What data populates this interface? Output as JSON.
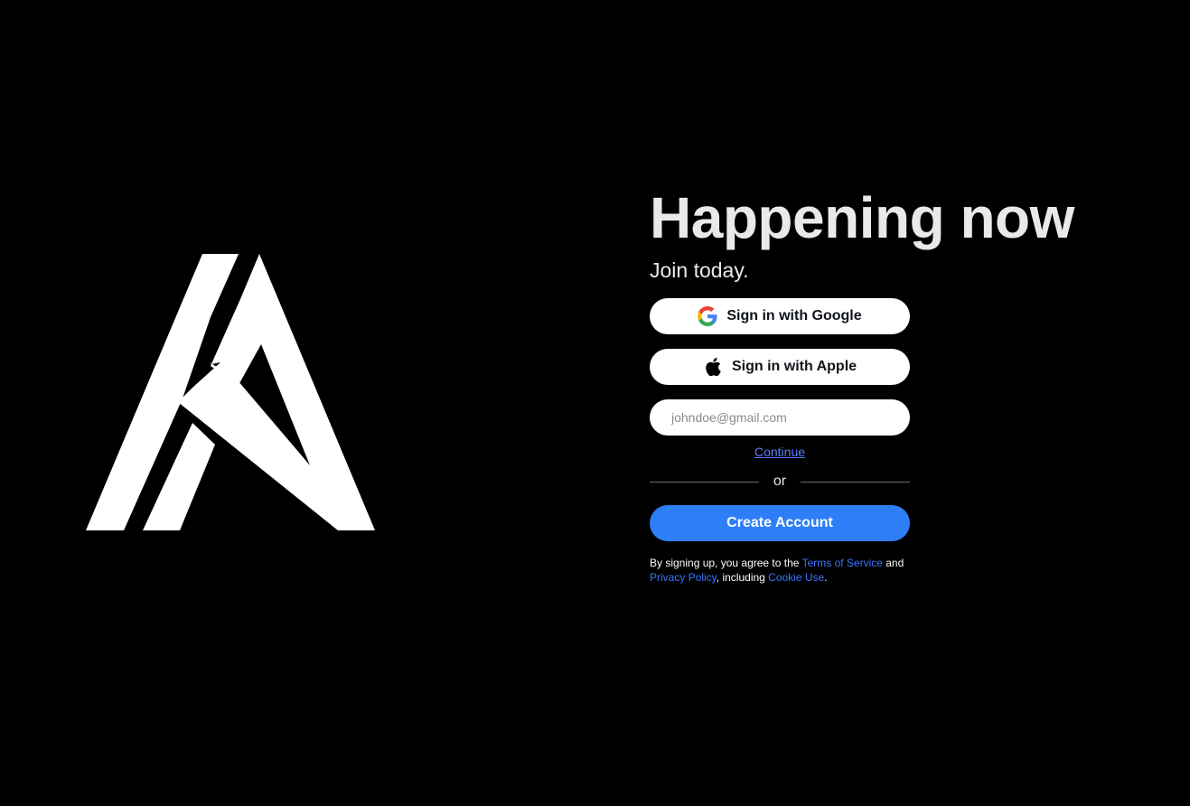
{
  "brand": {
    "logo_icon": "brand-logo-icon"
  },
  "main": {
    "headline": "Happening now",
    "subhead": "Join today."
  },
  "auth": {
    "google_label": "Sign in with Google",
    "google_icon": "google-icon",
    "apple_label": "Sign in with Apple",
    "apple_icon": "apple-icon",
    "email_placeholder": "johndoe@gmail.com",
    "email_value": "",
    "continue_label": "Continue",
    "divider_label": "or",
    "create_label": "Create Account"
  },
  "legal": {
    "prefix": "By signing up, you agree to the ",
    "terms_label": "Terms of Service",
    "and": " and",
    "privacy_label": "Privacy Policy",
    "including": ", including ",
    "cookie_label": "Cookie Use",
    "suffix": "."
  },
  "colors": {
    "background": "#000000",
    "primary_button": "#2d7ef7",
    "link": "#3b74ff",
    "text": "#e7e9ea"
  }
}
